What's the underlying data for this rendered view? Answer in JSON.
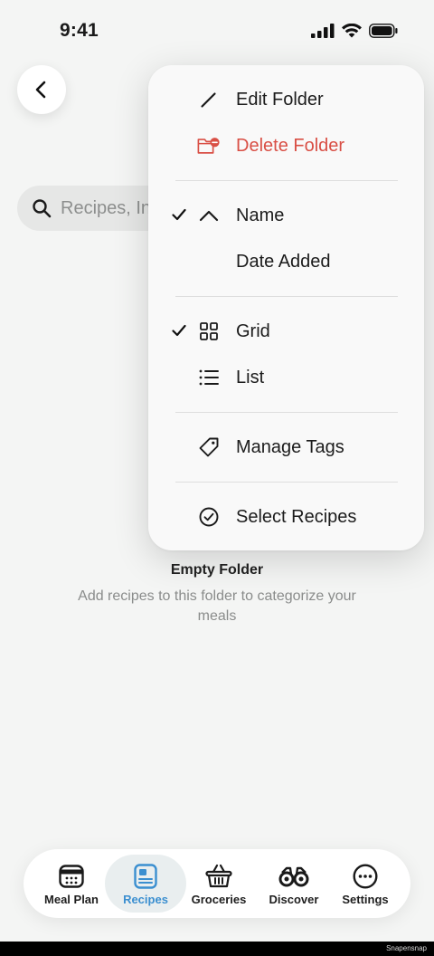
{
  "status": {
    "time": "9:41"
  },
  "search": {
    "placeholder": "Recipes, In"
  },
  "empty_state": {
    "title": "Empty Folder",
    "description": "Add recipes to this folder to categorize your meals"
  },
  "menu": {
    "edit_folder": "Edit Folder",
    "delete_folder": "Delete Folder",
    "sort_name": "Name",
    "sort_date_added": "Date Added",
    "view_grid": "Grid",
    "view_list": "List",
    "manage_tags": "Manage Tags",
    "select_recipes": "Select Recipes",
    "checked": [
      "Name",
      "Grid"
    ]
  },
  "tabs": [
    {
      "label": "Meal Plan",
      "icon": "calendar-icon"
    },
    {
      "label": "Recipes",
      "icon": "recipe-card-icon",
      "active": true
    },
    {
      "label": "Groceries",
      "icon": "basket-icon"
    },
    {
      "label": "Discover",
      "icon": "binoculars-icon"
    },
    {
      "label": "Settings",
      "icon": "more-icon"
    }
  ],
  "colors": {
    "danger": "#d94f45",
    "accent": "#3b8fd0"
  },
  "watermark": "Snapensnap"
}
